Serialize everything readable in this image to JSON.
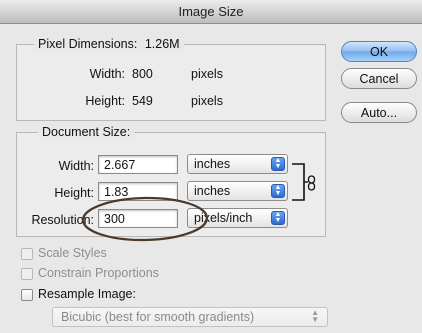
{
  "window": {
    "title": "Image Size"
  },
  "pixel_dimensions": {
    "legend": "Pixel Dimensions:",
    "size": "1.26M",
    "width_label": "Width:",
    "width_value": "800",
    "width_unit": "pixels",
    "height_label": "Height:",
    "height_value": "549",
    "height_unit": "pixels"
  },
  "buttons": {
    "ok": "OK",
    "cancel": "Cancel",
    "auto": "Auto..."
  },
  "document_size": {
    "legend": "Document Size:",
    "width_label": "Width:",
    "width_value": "2.667",
    "width_unit": "inches",
    "height_label": "Height:",
    "height_value": "1.83",
    "height_unit": "inches",
    "resolution_label": "Resolution:",
    "resolution_value": "300",
    "resolution_unit": "pixels/inch"
  },
  "options": {
    "scale_styles": {
      "label": "Scale Styles",
      "checked": false,
      "enabled": false
    },
    "constrain_proportions": {
      "label": "Constrain Proportions",
      "checked": false,
      "enabled": false
    },
    "resample_image": {
      "label": "Resample Image:",
      "checked": false,
      "enabled": true
    },
    "resample_method": "Bicubic (best for smooth gradients)"
  },
  "annotation": {
    "highlight_color": "#4a3a2c"
  },
  "icons": {
    "stepper": "stepper-arrows-icon",
    "link": "chain-link-icon"
  }
}
